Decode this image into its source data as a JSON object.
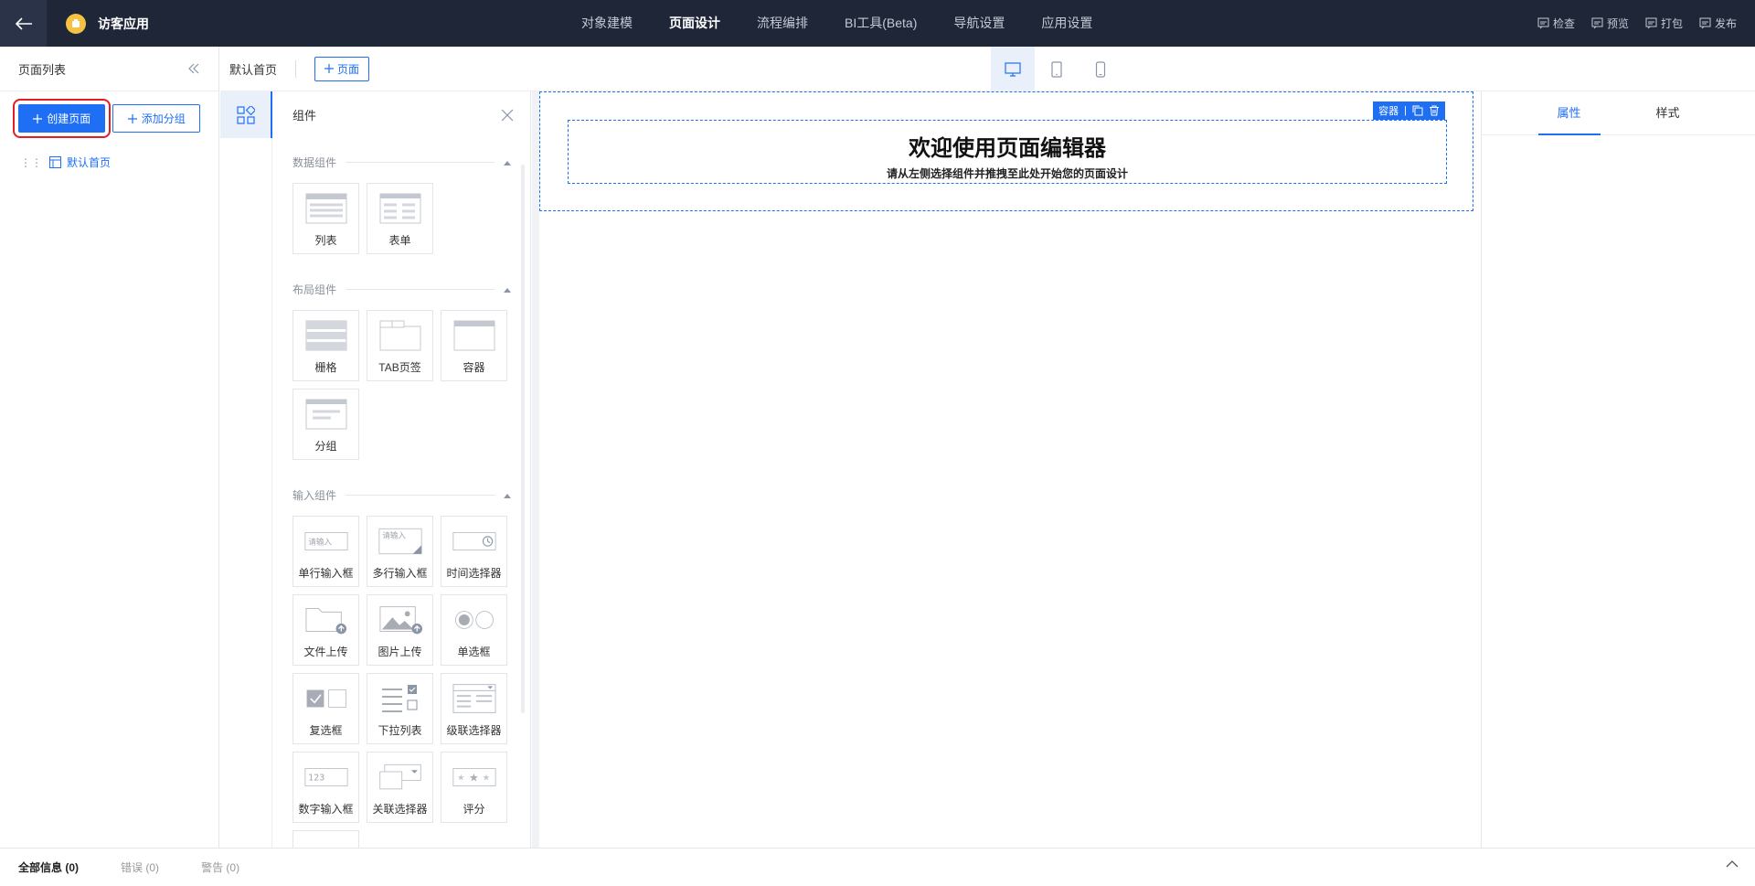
{
  "topbar": {
    "app_name": "访客应用",
    "nav": [
      "对象建模",
      "页面设计",
      "流程编排",
      "BI工具(Beta)",
      "导航设置",
      "应用设置"
    ],
    "actions": [
      "检查",
      "预览",
      "打包",
      "发布"
    ]
  },
  "pagelist": {
    "title": "页面列表",
    "create_btn": "创建页面",
    "add_group_btn": "添加分组",
    "pages": [
      "默认首页"
    ]
  },
  "tabs": {
    "current": "默认首页",
    "add_page": "页面"
  },
  "components": {
    "title": "组件",
    "groups": [
      {
        "title": "数据组件",
        "items": [
          {
            "label": "列表",
            "icon": "list-icon"
          },
          {
            "label": "表单",
            "icon": "form-icon"
          }
        ]
      },
      {
        "title": "布局组件",
        "items": [
          {
            "label": "栅格",
            "icon": "grid-icon"
          },
          {
            "label": "TAB页签",
            "icon": "tab-icon"
          },
          {
            "label": "容器",
            "icon": "container-icon"
          },
          {
            "label": "分组",
            "icon": "group-icon"
          }
        ]
      },
      {
        "title": "输入组件",
        "items": [
          {
            "label": "单行输入框",
            "icon": "single-input-icon"
          },
          {
            "label": "多行输入框",
            "icon": "textarea-icon"
          },
          {
            "label": "时间选择器",
            "icon": "time-picker-icon"
          },
          {
            "label": "文件上传",
            "icon": "file-upload-icon"
          },
          {
            "label": "图片上传",
            "icon": "image-upload-icon"
          },
          {
            "label": "单选框",
            "icon": "radio-icon"
          },
          {
            "label": "复选框",
            "icon": "checkbox-icon"
          },
          {
            "label": "下拉列表",
            "icon": "dropdown-icon"
          },
          {
            "label": "级联选择器",
            "icon": "cascader-icon"
          },
          {
            "label": "数字输入框",
            "icon": "number-input-icon"
          },
          {
            "label": "关联选择器",
            "icon": "relation-select-icon"
          },
          {
            "label": "评分",
            "icon": "rating-icon"
          }
        ]
      }
    ],
    "input_placeholder": "请输入",
    "number_sample": "123"
  },
  "canvas": {
    "container_label": "容器",
    "title": "欢迎使用页面编辑器",
    "subtitle": "请从左侧选择组件并推拽至此处开始您的页面设计"
  },
  "props": {
    "tabs": [
      "属性",
      "样式"
    ]
  },
  "bottombar": {
    "all": "全部信息",
    "all_count": "(0)",
    "errors": "错误",
    "errors_count": "(0)",
    "warnings": "警告",
    "warnings_count": "(0)"
  },
  "colors": {
    "primary": "#1f6ff5",
    "topbar": "#1e2638",
    "highlight": "#e11d25"
  }
}
